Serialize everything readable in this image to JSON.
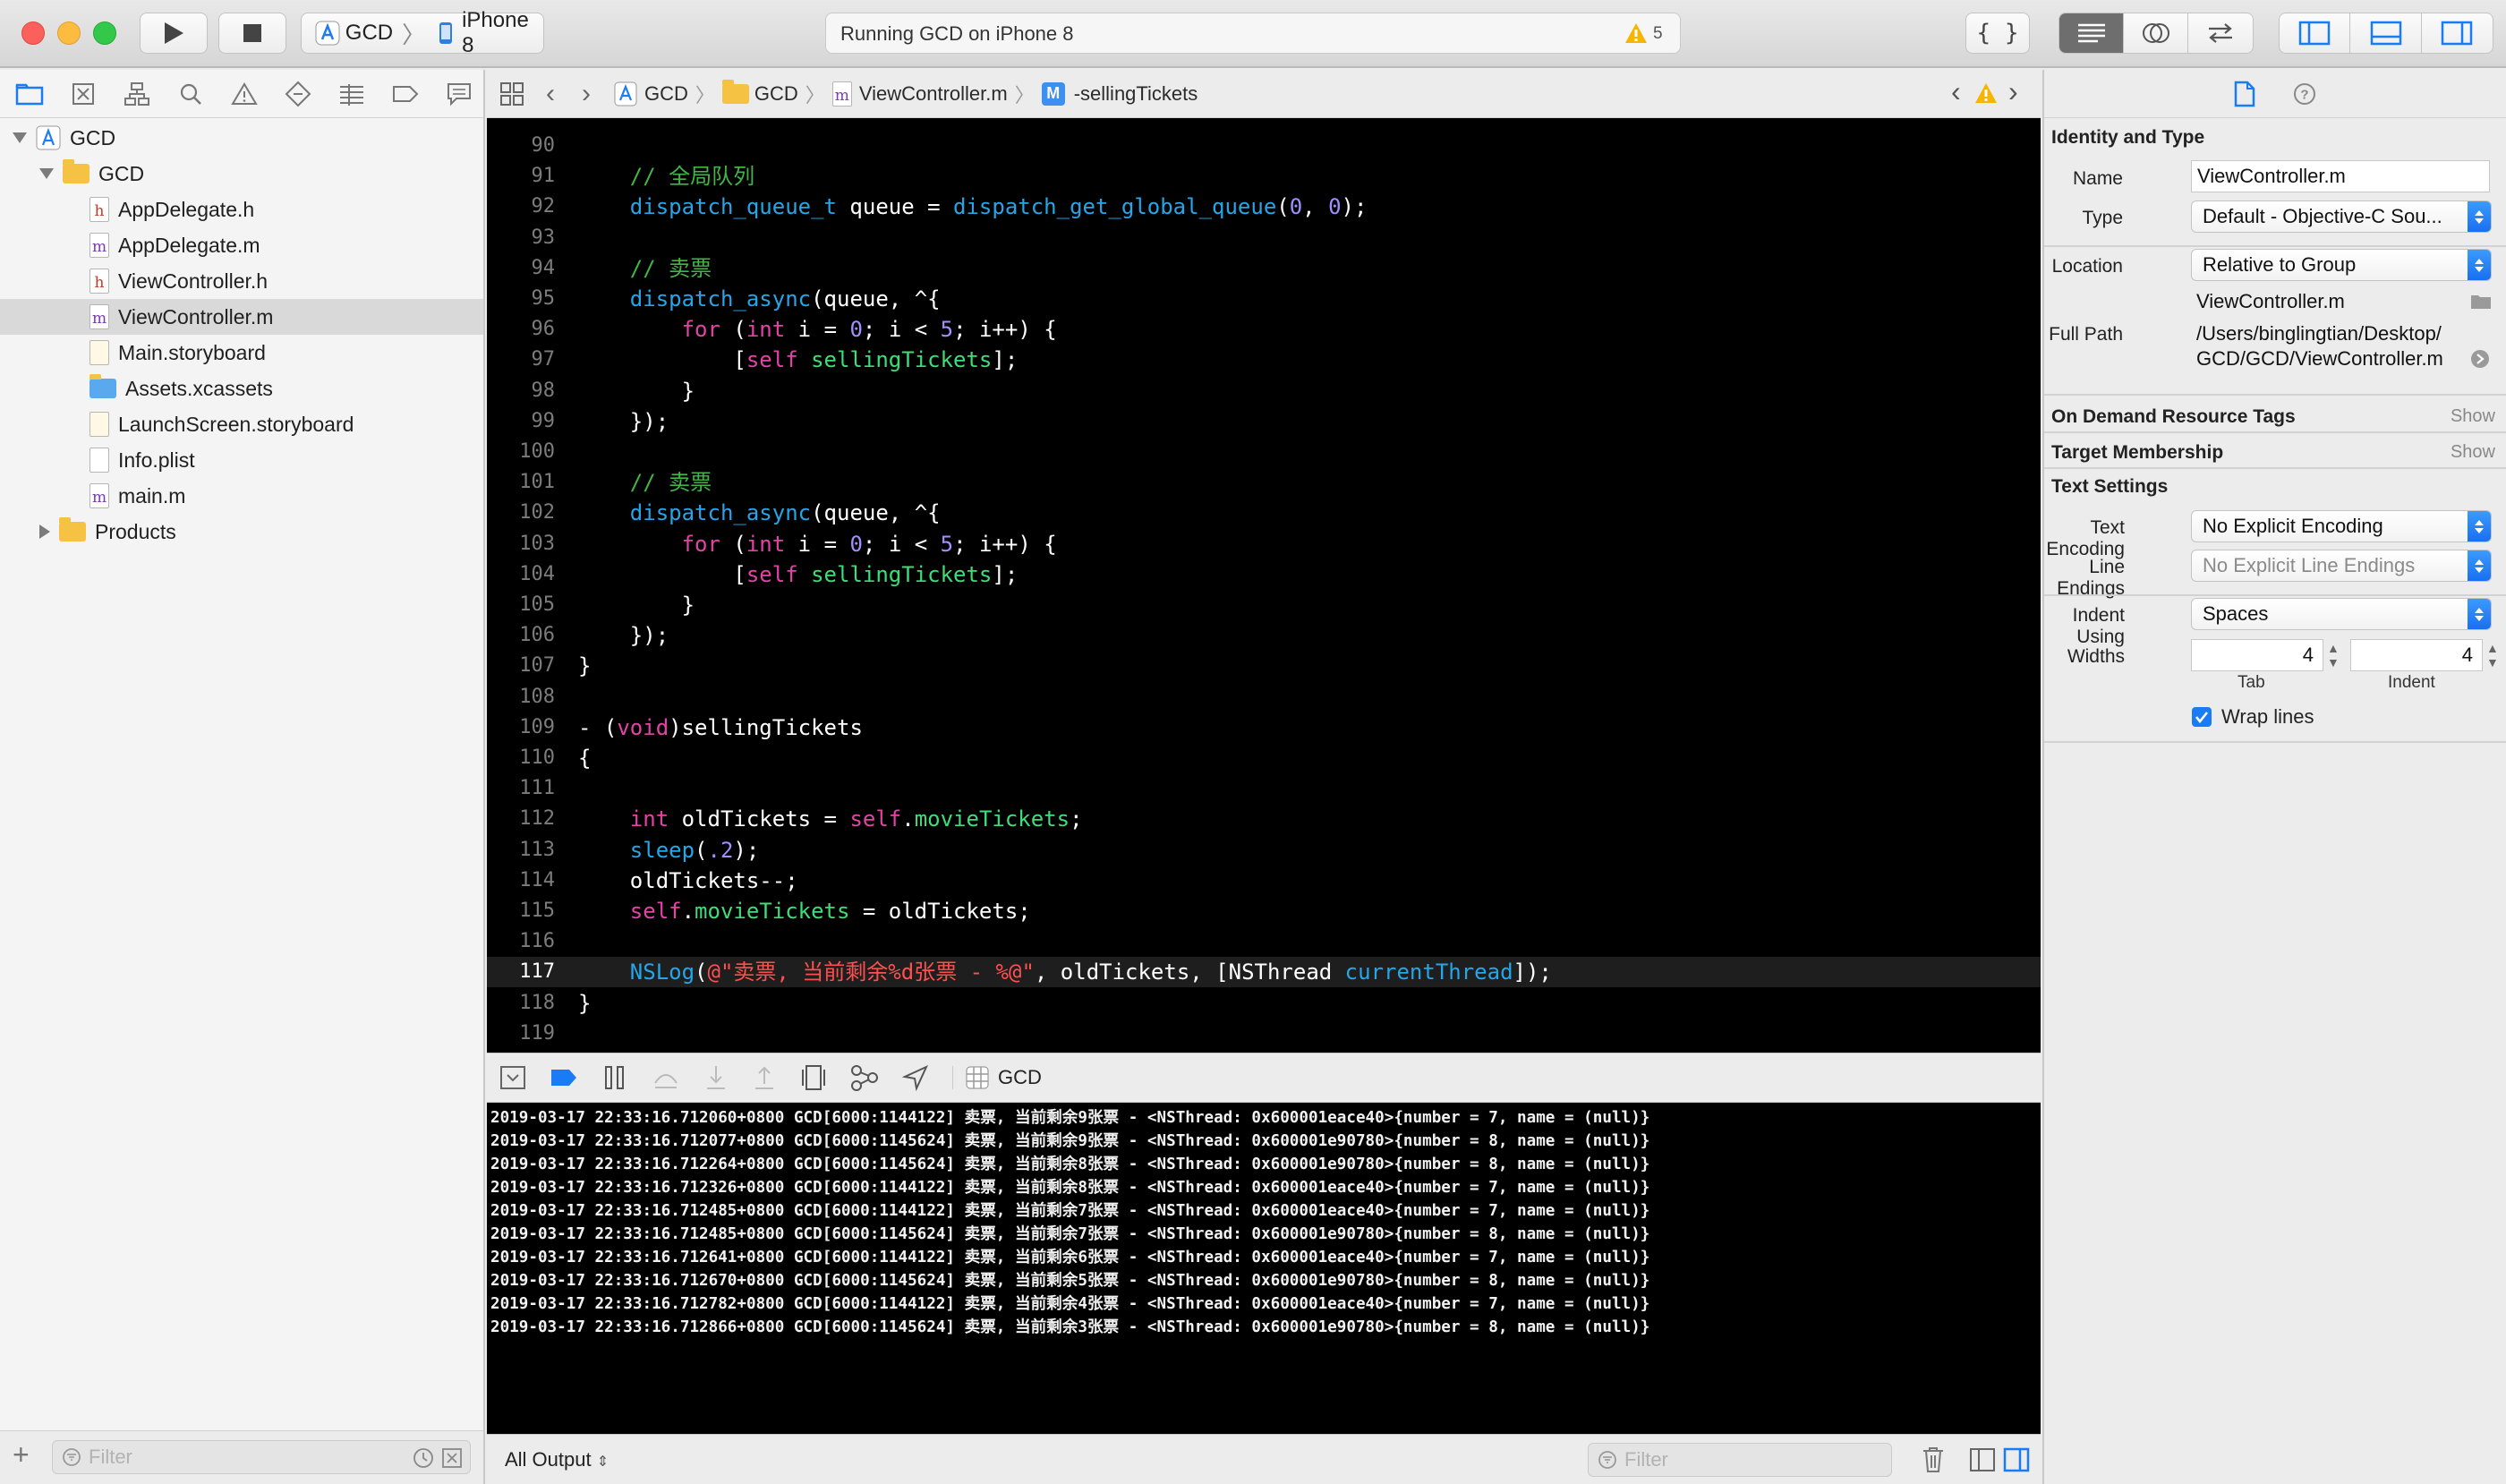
{
  "toolbar": {
    "scheme_name": "GCD",
    "device_name": "iPhone 8",
    "status_text": "Running GCD on iPhone 8",
    "warning_count": "5"
  },
  "navigator": {
    "items": [
      {
        "label": "GCD",
        "kind": "project",
        "level": 0,
        "open": true
      },
      {
        "label": "GCD",
        "kind": "folder",
        "level": 1,
        "open": true
      },
      {
        "label": "AppDelegate.h",
        "kind": "h",
        "level": 2
      },
      {
        "label": "AppDelegate.m",
        "kind": "m",
        "level": 2
      },
      {
        "label": "ViewController.h",
        "kind": "h",
        "level": 2
      },
      {
        "label": "ViewController.m",
        "kind": "m",
        "level": 2,
        "selected": true
      },
      {
        "label": "Main.storyboard",
        "kind": "storyboard",
        "level": 2
      },
      {
        "label": "Assets.xcassets",
        "kind": "assets",
        "level": 2
      },
      {
        "label": "LaunchScreen.storyboard",
        "kind": "storyboard",
        "level": 2
      },
      {
        "label": "Info.plist",
        "kind": "plist",
        "level": 2
      },
      {
        "label": "main.m",
        "kind": "m",
        "level": 2
      },
      {
        "label": "Products",
        "kind": "folder",
        "level": 1,
        "open": false
      }
    ],
    "filter_placeholder": "Filter"
  },
  "jumpbar": {
    "crumbs": [
      "GCD",
      "GCD",
      "ViewController.m",
      "-sellingTickets"
    ]
  },
  "editor": {
    "lines": [
      {
        "n": "90",
        "tokens": []
      },
      {
        "n": "91",
        "tokens": [
          [
            "    ",
            "t-plain"
          ],
          [
            "// 全局队列",
            "t-comment"
          ]
        ]
      },
      {
        "n": "92",
        "tokens": [
          [
            "    ",
            "t-plain"
          ],
          [
            "dispatch_queue_t",
            "t-func"
          ],
          [
            " queue = ",
            "t-plain"
          ],
          [
            "dispatch_get_global_queue",
            "t-func"
          ],
          [
            "(",
            "t-plain"
          ],
          [
            "0",
            "t-num"
          ],
          [
            ", ",
            "t-plain"
          ],
          [
            "0",
            "t-num"
          ],
          [
            ");",
            "t-plain"
          ]
        ]
      },
      {
        "n": "93",
        "tokens": []
      },
      {
        "n": "94",
        "tokens": [
          [
            "    ",
            "t-plain"
          ],
          [
            "// 卖票",
            "t-comment"
          ]
        ]
      },
      {
        "n": "95",
        "tokens": [
          [
            "    ",
            "t-plain"
          ],
          [
            "dispatch_async",
            "t-func"
          ],
          [
            "(queue, ^{",
            "t-plain"
          ]
        ]
      },
      {
        "n": "96",
        "tokens": [
          [
            "        ",
            "t-plain"
          ],
          [
            "for",
            "t-kw"
          ],
          [
            " (",
            "t-plain"
          ],
          [
            "int",
            "t-kw"
          ],
          [
            " i = ",
            "t-plain"
          ],
          [
            "0",
            "t-num"
          ],
          [
            "; i < ",
            "t-plain"
          ],
          [
            "5",
            "t-num"
          ],
          [
            "; i++) {",
            "t-plain"
          ]
        ]
      },
      {
        "n": "97",
        "tokens": [
          [
            "            [",
            "t-plain"
          ],
          [
            "self",
            "t-kw"
          ],
          [
            " ",
            "t-plain"
          ],
          [
            "sellingTickets",
            "t-prop"
          ],
          [
            "];",
            "t-plain"
          ]
        ]
      },
      {
        "n": "98",
        "tokens": [
          [
            "        }",
            "t-plain"
          ]
        ]
      },
      {
        "n": "99",
        "tokens": [
          [
            "    });",
            "t-plain"
          ]
        ]
      },
      {
        "n": "100",
        "tokens": []
      },
      {
        "n": "101",
        "tokens": [
          [
            "    ",
            "t-plain"
          ],
          [
            "// 卖票",
            "t-comment"
          ]
        ]
      },
      {
        "n": "102",
        "tokens": [
          [
            "    ",
            "t-plain"
          ],
          [
            "dispatch_async",
            "t-func"
          ],
          [
            "(queue, ^{",
            "t-plain"
          ]
        ]
      },
      {
        "n": "103",
        "tokens": [
          [
            "        ",
            "t-plain"
          ],
          [
            "for",
            "t-kw"
          ],
          [
            " (",
            "t-plain"
          ],
          [
            "int",
            "t-kw"
          ],
          [
            " i = ",
            "t-plain"
          ],
          [
            "0",
            "t-num"
          ],
          [
            "; i < ",
            "t-plain"
          ],
          [
            "5",
            "t-num"
          ],
          [
            "; i++) {",
            "t-plain"
          ]
        ]
      },
      {
        "n": "104",
        "tokens": [
          [
            "            [",
            "t-plain"
          ],
          [
            "self",
            "t-kw"
          ],
          [
            " ",
            "t-plain"
          ],
          [
            "sellingTickets",
            "t-prop"
          ],
          [
            "];",
            "t-plain"
          ]
        ]
      },
      {
        "n": "105",
        "tokens": [
          [
            "        }",
            "t-plain"
          ]
        ]
      },
      {
        "n": "106",
        "tokens": [
          [
            "    });",
            "t-plain"
          ]
        ]
      },
      {
        "n": "107",
        "tokens": [
          [
            "}",
            "t-plain"
          ]
        ]
      },
      {
        "n": "108",
        "tokens": []
      },
      {
        "n": "109",
        "tokens": [
          [
            "- (",
            "t-plain"
          ],
          [
            "void",
            "t-kw"
          ],
          [
            ")sellingTickets",
            "t-plain"
          ]
        ]
      },
      {
        "n": "110",
        "tokens": [
          [
            "{",
            "t-plain"
          ]
        ]
      },
      {
        "n": "111",
        "tokens": []
      },
      {
        "n": "112",
        "tokens": [
          [
            "    ",
            "t-plain"
          ],
          [
            "int",
            "t-kw"
          ],
          [
            " oldTickets = ",
            "t-plain"
          ],
          [
            "self",
            "t-kw"
          ],
          [
            ".",
            "t-plain"
          ],
          [
            "movieTickets",
            "t-prop"
          ],
          [
            ";",
            "t-plain"
          ]
        ]
      },
      {
        "n": "113",
        "tokens": [
          [
            "    ",
            "t-plain"
          ],
          [
            "sleep",
            "t-func"
          ],
          [
            "(",
            "t-plain"
          ],
          [
            ".2",
            "t-num"
          ],
          [
            ");",
            "t-plain"
          ]
        ]
      },
      {
        "n": "114",
        "tokens": [
          [
            "    oldTickets--;",
            "t-plain"
          ]
        ]
      },
      {
        "n": "115",
        "tokens": [
          [
            "    ",
            "t-plain"
          ],
          [
            "self",
            "t-kw"
          ],
          [
            ".",
            "t-plain"
          ],
          [
            "movieTickets",
            "t-prop"
          ],
          [
            " = oldTickets;",
            "t-plain"
          ]
        ]
      },
      {
        "n": "116",
        "tokens": []
      },
      {
        "n": "117",
        "current": true,
        "tokens": [
          [
            "    ",
            "t-plain"
          ],
          [
            "NSLog",
            "t-func"
          ],
          [
            "(",
            "t-plain"
          ],
          [
            "@\"卖票, 当前剩余%d张票 - %@\"",
            "t-str"
          ],
          [
            ", oldTickets, [NSThread ",
            "t-plain"
          ],
          [
            "currentThread",
            "t-func"
          ],
          [
            "]);",
            "t-plain"
          ]
        ]
      },
      {
        "n": "118",
        "tokens": [
          [
            "}",
            "t-plain"
          ]
        ]
      },
      {
        "n": "119",
        "tokens": []
      }
    ]
  },
  "debug": {
    "target_label": "GCD",
    "log_lines": [
      "2019-03-17 22:33:16.712060+0800 GCD[6000:1144122] 卖票, 当前剩余9张票 - <NSThread: 0x600001eace40>{number = 7, name = (null)}",
      "2019-03-17 22:33:16.712077+0800 GCD[6000:1145624] 卖票, 当前剩余9张票 - <NSThread: 0x600001e90780>{number = 8, name = (null)}",
      "2019-03-17 22:33:16.712264+0800 GCD[6000:1145624] 卖票, 当前剩余8张票 - <NSThread: 0x600001e90780>{number = 8, name = (null)}",
      "2019-03-17 22:33:16.712326+0800 GCD[6000:1144122] 卖票, 当前剩余8张票 - <NSThread: 0x600001eace40>{number = 7, name = (null)}",
      "2019-03-17 22:33:16.712485+0800 GCD[6000:1144122] 卖票, 当前剩余7张票 - <NSThread: 0x600001eace40>{number = 7, name = (null)}",
      "2019-03-17 22:33:16.712485+0800 GCD[6000:1145624] 卖票, 当前剩余7张票 - <NSThread: 0x600001e90780>{number = 8, name = (null)}",
      "2019-03-17 22:33:16.712641+0800 GCD[6000:1144122] 卖票, 当前剩余6张票 - <NSThread: 0x600001eace40>{number = 7, name = (null)}",
      "2019-03-17 22:33:16.712670+0800 GCD[6000:1145624] 卖票, 当前剩余5张票 - <NSThread: 0x600001e90780>{number = 8, name = (null)}",
      "2019-03-17 22:33:16.712782+0800 GCD[6000:1144122] 卖票, 当前剩余4张票 - <NSThread: 0x600001eace40>{number = 7, name = (null)}",
      "2019-03-17 22:33:16.712866+0800 GCD[6000:1145624] 卖票, 当前剩余3张票 - <NSThread: 0x600001e90780>{number = 8, name = (null)}"
    ],
    "output_selector": "All Output",
    "filter_placeholder": "Filter"
  },
  "inspector": {
    "identity_title": "Identity and Type",
    "name_label": "Name",
    "name_value": "ViewController.m",
    "type_label": "Type",
    "type_value": "Default - Objective-C Sou...",
    "location_label": "Location",
    "location_value": "Relative to Group",
    "location_file": "ViewController.m",
    "fullpath_label": "Full Path",
    "fullpath_line1": "/Users/binglingtian/Desktop/",
    "fullpath_line2": "GCD/GCD/ViewController.m",
    "odr_title": "On Demand Resource Tags",
    "odr_show": "Show",
    "target_title": "Target Membership",
    "target_show": "Show",
    "text_settings_title": "Text Settings",
    "encoding_label": "Text Encoding",
    "encoding_value": "No Explicit Encoding",
    "endings_label": "Line Endings",
    "endings_value": "No Explicit Line Endings",
    "indent_label": "Indent Using",
    "indent_value": "Spaces",
    "widths_label": "Widths",
    "tab_value": "4",
    "indent_width_value": "4",
    "tab_caption": "Tab",
    "indent_caption": "Indent",
    "wrap_label": "Wrap lines"
  },
  "colors": {
    "accent": "#1a7cf5",
    "warning": "#f5b500"
  }
}
